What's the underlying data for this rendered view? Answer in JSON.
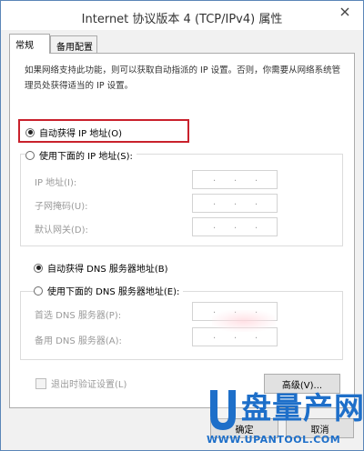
{
  "window": {
    "title": "Internet 协议版本 4 (TCP/IPv4) 属性",
    "close_icon": "close-icon"
  },
  "tabs": [
    {
      "label": "常规",
      "active": true
    },
    {
      "label": "备用配置",
      "active": false
    }
  ],
  "general": {
    "description": "如果网络支持此功能，则可以获取自动指派的 IP 设置。否则，你需要从网络系统管理员处获得适当的 IP 设置。",
    "ip_mode": {
      "auto_label": "自动获得 IP 地址(O)",
      "manual_label": "使用下面的 IP 地址(S):",
      "selected": "auto"
    },
    "ip_fields": [
      {
        "label": "IP 地址(I):",
        "value": "",
        "separators": ". . ."
      },
      {
        "label": "子网掩码(U):",
        "value": "",
        "separators": ". . ."
      },
      {
        "label": "默认网关(D):",
        "value": "",
        "separators": ". . ."
      }
    ],
    "dns_mode": {
      "auto_label": "自动获得 DNS 服务器地址(B)",
      "manual_label": "使用下面的 DNS 服务器地址(E):",
      "selected": "auto"
    },
    "dns_fields": [
      {
        "label": "首选 DNS 服务器(P):",
        "value": "",
        "separators": ". . ."
      },
      {
        "label": "备用 DNS 服务器(A):",
        "value": "",
        "separators": ". . ."
      }
    ],
    "validate_label": "退出时验证设置(L)",
    "validate_checked": false,
    "advanced_label": "高级(V)..."
  },
  "footer": {
    "ok_label": "确定",
    "cancel_label": "取消"
  },
  "watermark": {
    "brand": "盘量产网",
    "url": "WWW.UPANTOOL.COM",
    "color": "#1e6fc9"
  },
  "colors": {
    "highlight": "#c9212c",
    "title_border": "#5b86b8"
  }
}
